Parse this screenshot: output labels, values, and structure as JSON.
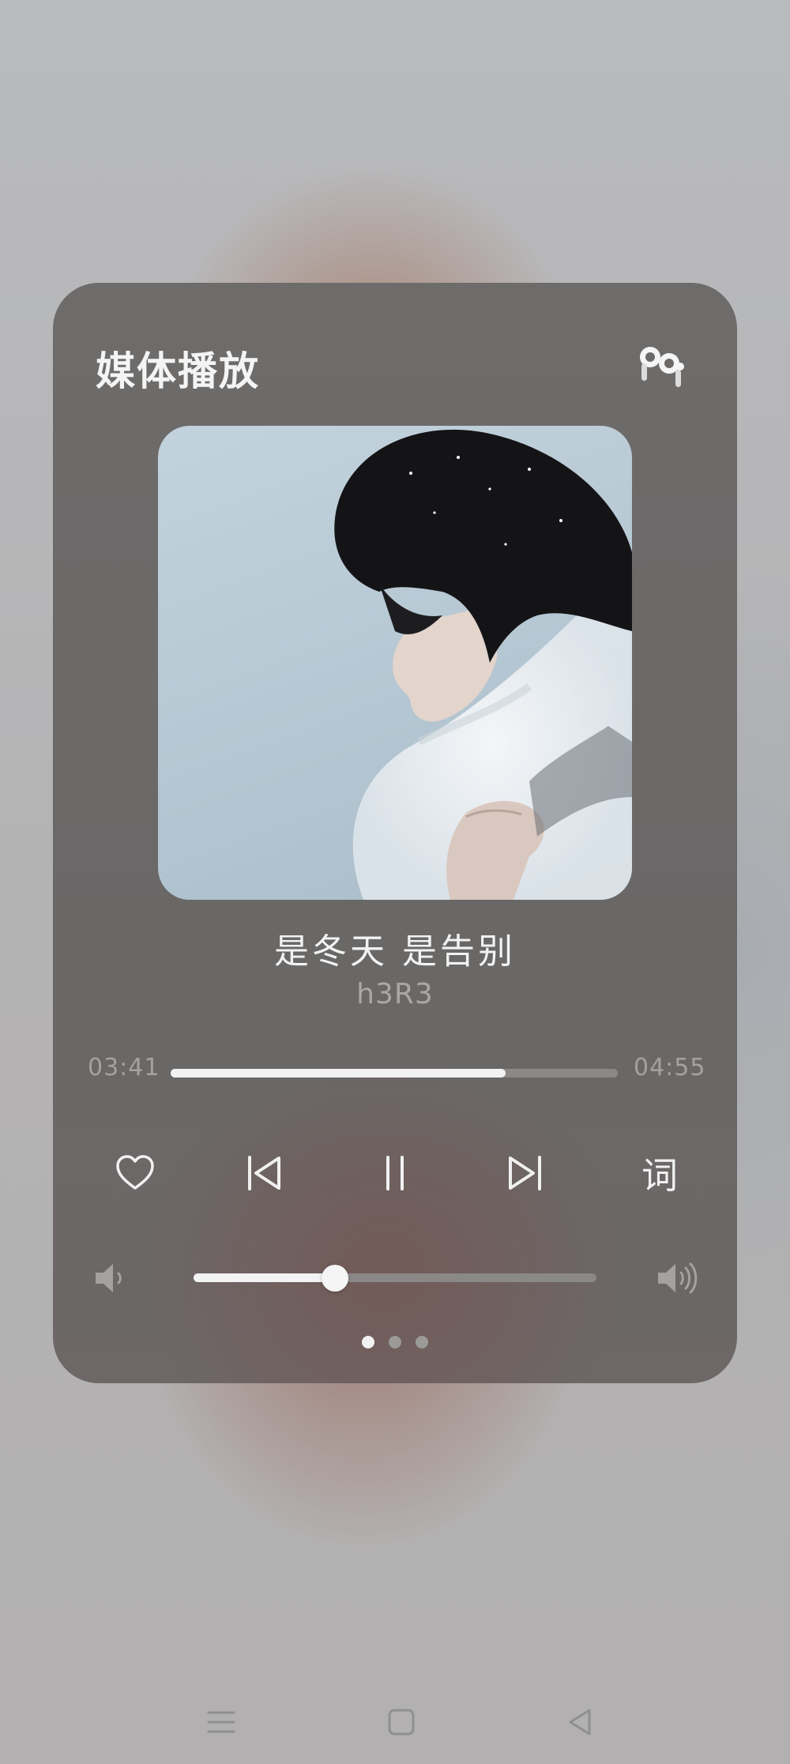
{
  "card": {
    "title": "媒体播放"
  },
  "track": {
    "title": "是冬天 是告别",
    "artist": "h3R3"
  },
  "progress": {
    "elapsed": "03:41",
    "total": "04:55",
    "fraction": 0.749
  },
  "controls": {
    "like_icon": "heart-outline-icon",
    "previous_icon": "skip-previous-icon",
    "play_pause_icon": "pause-icon",
    "next_icon": "skip-next-icon",
    "lyrics_label": "词"
  },
  "volume": {
    "level": 0.35,
    "low_icon": "volume-low-icon",
    "high_icon": "volume-high-icon"
  },
  "pager": {
    "count": 3,
    "active": 0
  },
  "nav_bar": {
    "menu_icon": "menu-icon",
    "home_icon": "home-icon",
    "back_icon": "back-icon"
  },
  "colors": {
    "accent": "#f2f2f2",
    "card_background": "#6b6a69",
    "app_badge": "#e5261e"
  }
}
